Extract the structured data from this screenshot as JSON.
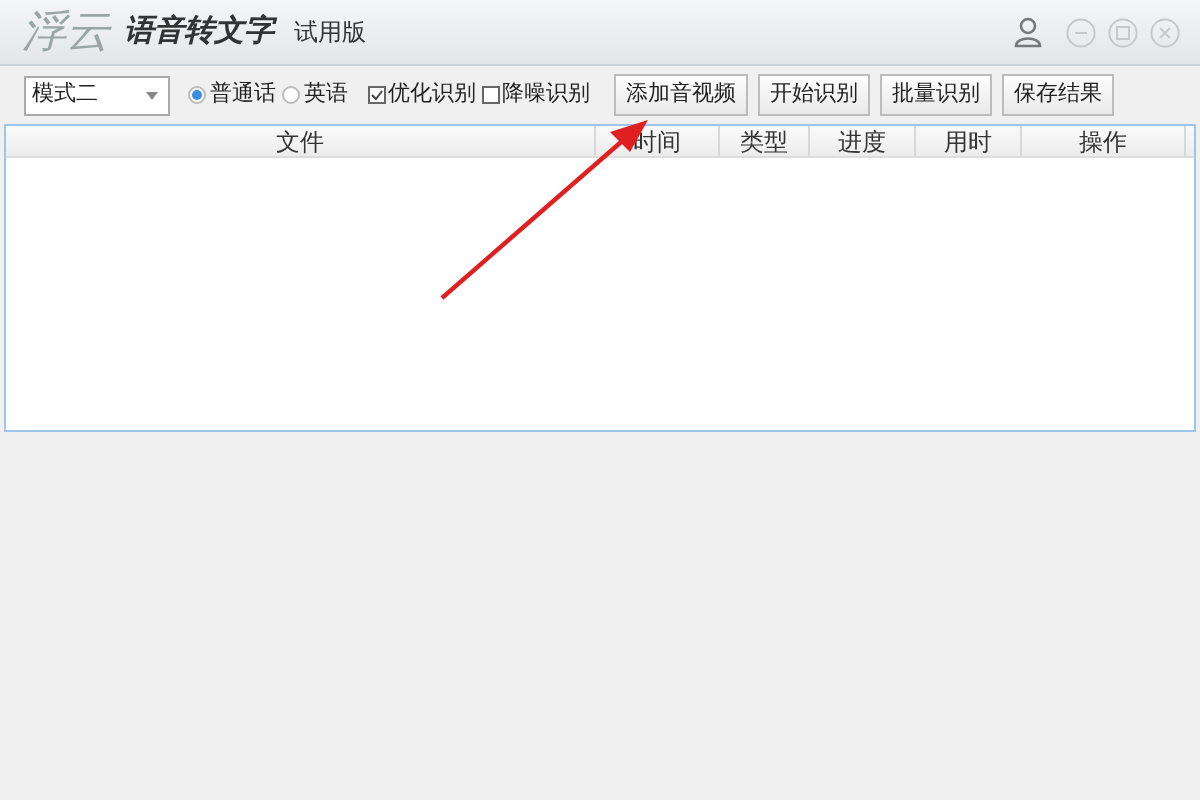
{
  "window": {
    "logo": "浮云",
    "title": "语音转文字",
    "edition": "试用版"
  },
  "toolbar": {
    "mode": "模式二",
    "languages": [
      {
        "label": "普通话",
        "selected": true
      },
      {
        "label": "英语",
        "selected": false
      }
    ],
    "options": [
      {
        "label": "优化识别",
        "checked": true
      },
      {
        "label": "降噪识别",
        "checked": false
      }
    ],
    "buttons": [
      "添加音视频",
      "开始识别",
      "批量识别",
      "保存结果"
    ]
  },
  "table": {
    "columns": [
      "文件",
      "时间",
      "类型",
      "进度",
      "用时",
      "操作"
    ]
  }
}
